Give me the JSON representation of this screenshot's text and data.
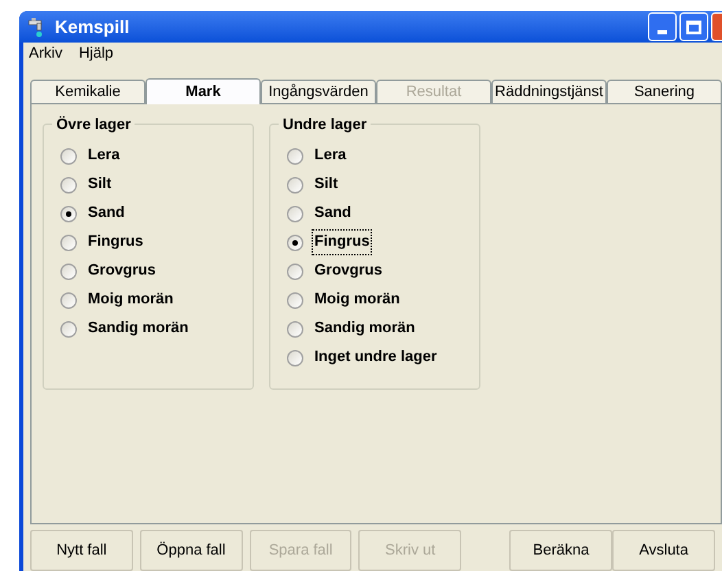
{
  "window": {
    "title": "Kemspill"
  },
  "menu": [
    "Arkiv",
    "Hjälp"
  ],
  "tabs": [
    {
      "label": "Kemikalie",
      "selected": false,
      "disabled": false
    },
    {
      "label": "Mark",
      "selected": true,
      "disabled": false
    },
    {
      "label": "Ingångsvärden",
      "selected": false,
      "disabled": false
    },
    {
      "label": "Resultat",
      "selected": false,
      "disabled": true
    },
    {
      "label": "Räddningstjänst",
      "selected": false,
      "disabled": false
    },
    {
      "label": "Sanering",
      "selected": false,
      "disabled": false
    }
  ],
  "groups": [
    {
      "title": "Övre lager",
      "options": [
        {
          "label": "Lera",
          "selected": false,
          "focused": false
        },
        {
          "label": "Silt",
          "selected": false,
          "focused": false
        },
        {
          "label": "Sand",
          "selected": true,
          "focused": false
        },
        {
          "label": "Fingrus",
          "selected": false,
          "focused": false
        },
        {
          "label": "Grovgrus",
          "selected": false,
          "focused": false
        },
        {
          "label": "Moig morän",
          "selected": false,
          "focused": false
        },
        {
          "label": "Sandig morän",
          "selected": false,
          "focused": false
        }
      ]
    },
    {
      "title": "Undre lager",
      "options": [
        {
          "label": "Lera",
          "selected": false,
          "focused": false
        },
        {
          "label": "Silt",
          "selected": false,
          "focused": false
        },
        {
          "label": "Sand",
          "selected": false,
          "focused": false
        },
        {
          "label": "Fingrus",
          "selected": true,
          "focused": true
        },
        {
          "label": "Grovgrus",
          "selected": false,
          "focused": false
        },
        {
          "label": "Moig morän",
          "selected": false,
          "focused": false
        },
        {
          "label": "Sandig morän",
          "selected": false,
          "focused": false
        },
        {
          "label": "Inget undre lager",
          "selected": false,
          "focused": false
        }
      ]
    }
  ],
  "buttons": [
    {
      "label": "Nytt fall",
      "disabled": false
    },
    {
      "label": "Öppna fall",
      "disabled": false
    },
    {
      "label": "Spara fall",
      "disabled": true
    },
    {
      "label": "Skriv ut",
      "disabled": true
    },
    {
      "label": "Beräkna",
      "disabled": false
    },
    {
      "label": "Avsluta",
      "disabled": false
    }
  ]
}
